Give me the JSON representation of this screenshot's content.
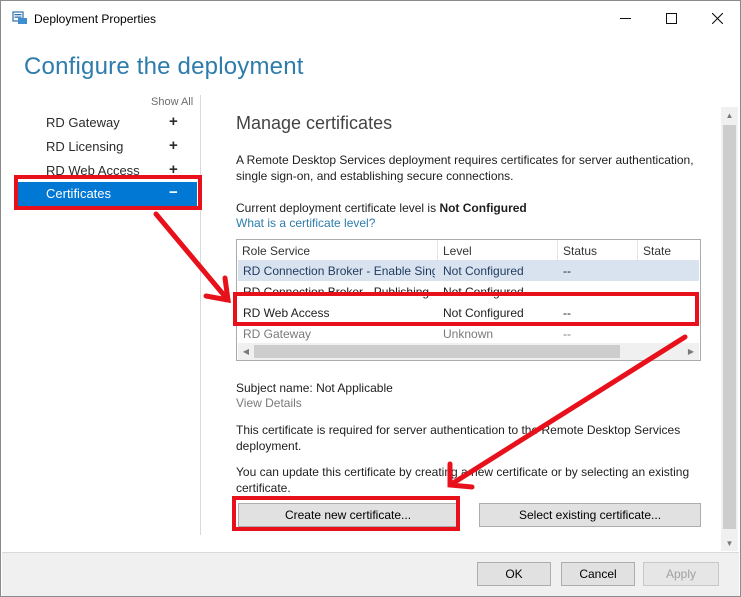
{
  "window": {
    "title": "Deployment Properties"
  },
  "heading": "Configure the deployment",
  "sidebar": {
    "show_all": "Show All",
    "items": [
      {
        "label": "RD Gateway",
        "toggle": "+"
      },
      {
        "label": "RD Licensing",
        "toggle": "+"
      },
      {
        "label": "RD Web Access",
        "toggle": "+"
      },
      {
        "label": "Certificates",
        "toggle": "−",
        "active": true
      }
    ]
  },
  "main": {
    "section_title": "Manage certificates",
    "description": "A Remote Desktop Services deployment requires certificates for server authentication, single sign-on, and establishing secure connections.",
    "level_prefix": "Current deployment certificate level is",
    "level_value": "Not Configured",
    "level_link": "What is a certificate level?",
    "table": {
      "columns": [
        "Role Service",
        "Level",
        "Status",
        "State"
      ],
      "rows": [
        {
          "role": "RD Connection Broker - Enable Single Sign On",
          "level": "Not Configured",
          "status": "--",
          "state": ""
        },
        {
          "role": "RD Connection Broker - Publishing",
          "level": "Not Configured",
          "status": "--",
          "state": ""
        },
        {
          "role": "RD Web Access",
          "level": "Not Configured",
          "status": "--",
          "state": ""
        },
        {
          "role": "RD Gateway",
          "level": "Unknown",
          "status": "--",
          "state": ""
        }
      ]
    },
    "subject_label": "Subject name:",
    "subject_value": "Not Applicable",
    "view_details": "View Details",
    "required_text": "This certificate is required for server authentication to the Remote Desktop Services deployment.",
    "update_text": "You can update this certificate by creating a new certificate or by selecting an existing certificate.",
    "create_button": "Create new certificate...",
    "select_button": "Select existing certificate..."
  },
  "footer": {
    "ok": "OK",
    "cancel": "Cancel",
    "apply": "Apply"
  },
  "colors": {
    "accent": "#0078d4",
    "heading": "#2d7cab",
    "highlight": "#e8101a"
  }
}
